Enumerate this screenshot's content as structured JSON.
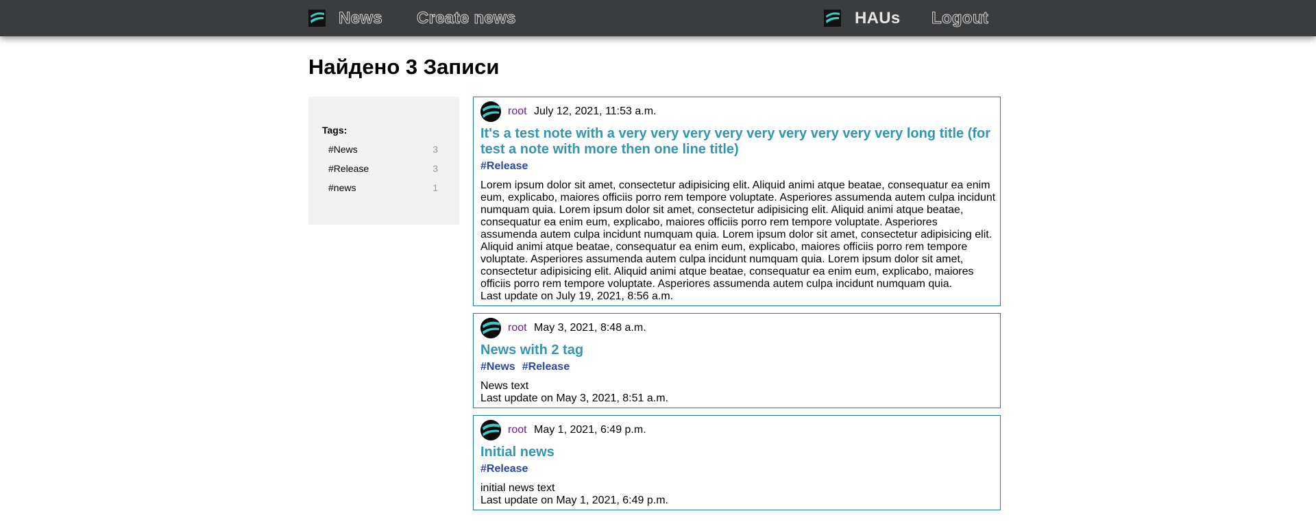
{
  "nav": {
    "news": "News",
    "create_news": "Create news",
    "user": "HAUs",
    "logout": "Logout"
  },
  "page": {
    "title": "Найдено 3 Записи"
  },
  "sidebar": {
    "tags_title": "Tags:",
    "tags": [
      {
        "name": "#News",
        "count": "3"
      },
      {
        "name": "#Release",
        "count": "3"
      },
      {
        "name": "#news",
        "count": "1"
      }
    ]
  },
  "posts": [
    {
      "author": "root",
      "date": "July 12, 2021, 11:53 a.m.",
      "title": "It's a test note with a very very very very very very very very very long title (for test a note with more then one line title)",
      "tags": [
        "#Release"
      ],
      "text": "Lorem ipsum dolor sit amet, consectetur adipisicing elit. Aliquid animi atque beatae, consequatur ea enim eum, explicabo, maiores officiis porro rem tempore voluptate. Asperiores assumenda autem culpa incidunt numquam quia. Lorem ipsum dolor sit amet, consectetur adipisicing elit. Aliquid animi atque beatae, consequatur ea enim eum, explicabo, maiores officiis porro rem tempore voluptate. Asperiores assumenda autem culpa incidunt numquam quia. Lorem ipsum dolor sit amet, consectetur adipisicing elit. Aliquid animi atque beatae, consequatur ea enim eum, explicabo, maiores officiis porro rem tempore voluptate. Asperiores assumenda autem culpa incidunt numquam quia. Lorem ipsum dolor sit amet, consectetur adipisicing elit. Aliquid animi atque beatae, consequatur ea enim eum, explicabo, maiores officiis porro rem tempore voluptate. Asperiores assumenda autem culpa incidunt numquam quia.",
      "updated": "Last update on July 19, 2021, 8:56 a.m."
    },
    {
      "author": "root",
      "date": "May 3, 2021, 8:48 a.m.",
      "title": "News with 2 tag",
      "tags": [
        "#News",
        "#Release"
      ],
      "text": "News text",
      "updated": "Last update on May 3, 2021, 8:51 a.m."
    },
    {
      "author": "root",
      "date": "May 1, 2021, 6:49 p.m.",
      "title": "Initial news",
      "tags": [
        "#Release"
      ],
      "text": "initial news text",
      "updated": "Last update on May 1, 2021, 6:49 p.m."
    }
  ],
  "colors": {
    "topbar": "#3b3c3e",
    "card_border": "#1f7f9a",
    "title_link": "#3495b0",
    "tag_link": "#2a48a8",
    "author_link": "#6a1b9a",
    "logo_accent": "#3fc9c9"
  },
  "icons": {
    "site_logo": "site-logo-icon",
    "user_logo": "user-logo-icon",
    "avatar": "avatar-logo-icon"
  }
}
